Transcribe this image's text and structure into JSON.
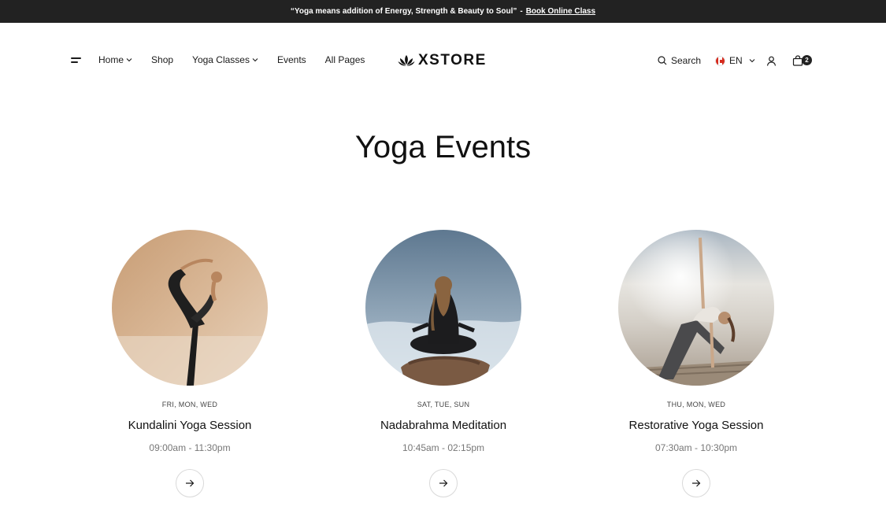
{
  "announcement": {
    "quote": "“Yoga means addition of Energy, Strength & Beauty to Soul”",
    "separator": "-",
    "link_label": "Book Online Class"
  },
  "header": {
    "menu_icon": "menu-icon",
    "nav": [
      {
        "label": "Home",
        "has_dropdown": true
      },
      {
        "label": "Shop",
        "has_dropdown": false
      },
      {
        "label": "Yoga Classes",
        "has_dropdown": true
      },
      {
        "label": "Events",
        "has_dropdown": false
      },
      {
        "label": "All Pages",
        "has_dropdown": false
      }
    ],
    "logo_text": "XSTORE",
    "search_label": "Search",
    "language_code": "EN",
    "cart_count": "2"
  },
  "main": {
    "title": "Yoga Events",
    "events": [
      {
        "days": "FRI, MON, WED",
        "name": "Kundalini Yoga Session",
        "time": "09:00am - 11:30pm"
      },
      {
        "days": "SAT, TUE, SUN",
        "name": "Nadabrahma Meditation",
        "time": "10:45am - 02:15pm"
      },
      {
        "days": "THU, MON, WED",
        "name": "Restorative Yoga Session",
        "time": "07:30am - 10:30pm"
      }
    ]
  },
  "colors": {
    "topbar_bg": "#222222",
    "text": "#1a1a1a",
    "muted": "#777777",
    "flag_red": "#d52b1e"
  }
}
